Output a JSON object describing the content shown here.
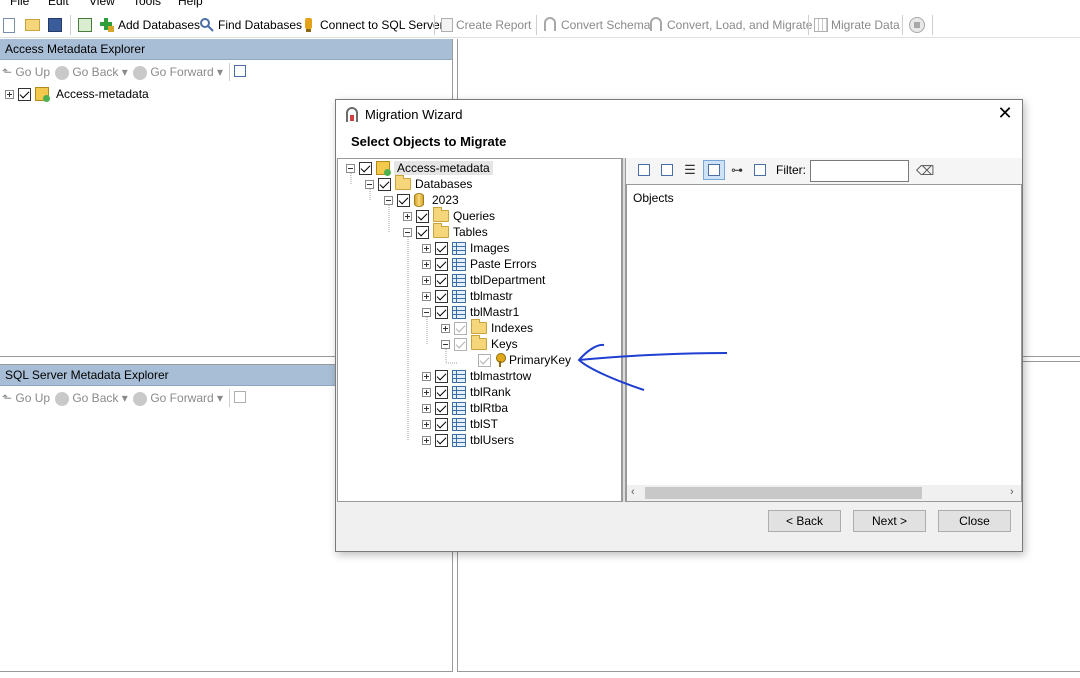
{
  "menu": [
    "File",
    "Edit",
    "View",
    "Tools",
    "Help"
  ],
  "toolbar": {
    "add_databases": "Add Databases",
    "find_databases": "Find Databases",
    "connect_sql": "Connect to SQL Server",
    "create_report": "Create Report",
    "convert_schema": "Convert Schema",
    "convert_load_migrate": "Convert, Load, and Migrate",
    "migrate_data": "Migrate Data"
  },
  "access_explorer": {
    "title": "Access Metadata Explorer",
    "go_up": "Go Up",
    "go_back": "Go Back",
    "go_forward": "Go Forward",
    "root": "Access-metadata"
  },
  "sql_explorer": {
    "title": "SQL Server Metadata Explorer",
    "go_up": "Go Up",
    "go_back": "Go Back",
    "go_forward": "Go Forward"
  },
  "dialog": {
    "title": "Migration Wizard",
    "subtitle": "Select Objects to Migrate",
    "filter_label": "Filter:",
    "filter_value": "",
    "objects_header": "Objects",
    "back": "< Back",
    "next": "Next >",
    "close": "Close",
    "tree": {
      "root": "Access-metadata",
      "databases": "Databases",
      "db": "2023",
      "queries": "Queries",
      "tables": "Tables",
      "t_images": "Images",
      "t_paste_errors": "Paste Errors",
      "t_department": "tblDepartment",
      "t_mastr": "tblmastr",
      "t_mastr1": "tblMastr1",
      "indexes": "Indexes",
      "keys": "Keys",
      "primary_key": "PrimaryKey",
      "t_mastrtow": "tblmastrtow",
      "t_rank": "tblRank",
      "t_rtba": "tblRtba",
      "t_st": "tblST",
      "t_users": "tblUsers"
    }
  },
  "colors": {
    "panel_title": "#a8bed6",
    "annotation": "#1f3fd1"
  }
}
